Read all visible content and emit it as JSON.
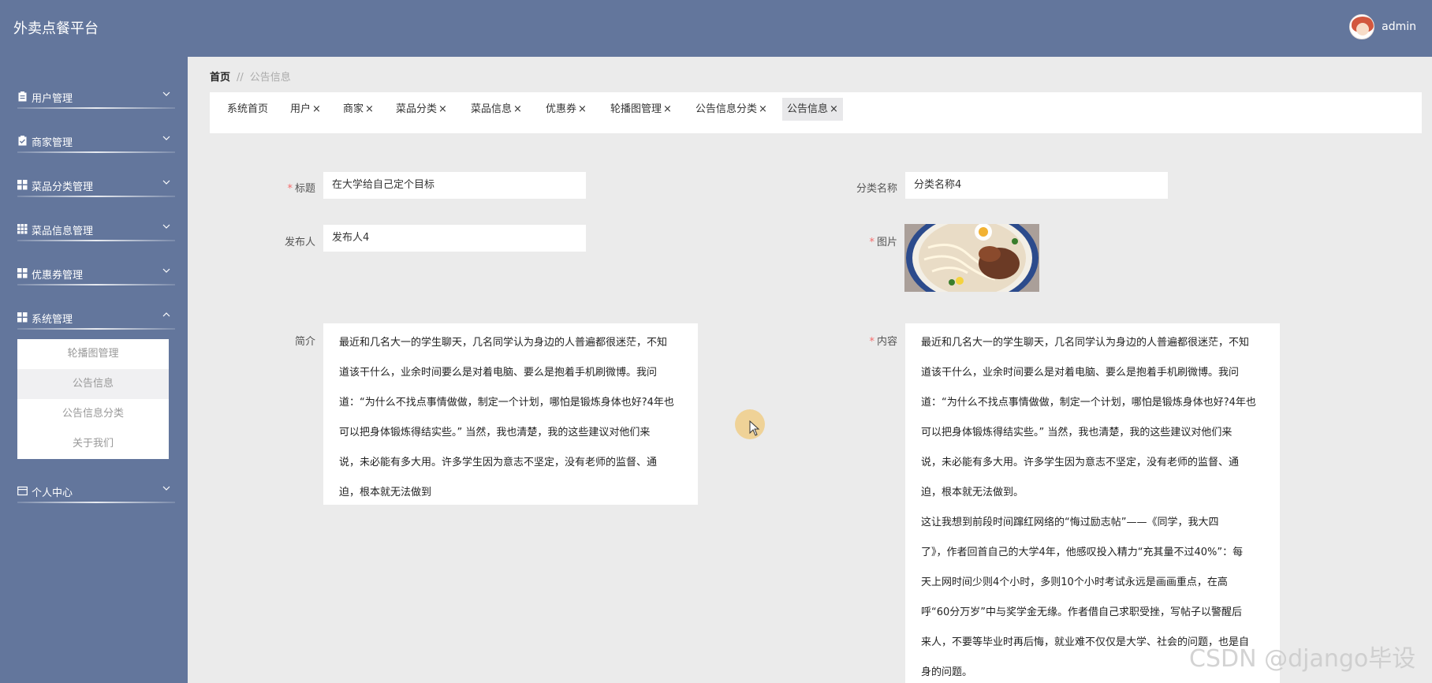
{
  "header": {
    "app_title": "外卖点餐平台",
    "username": "admin"
  },
  "sidebar": {
    "items": [
      {
        "label": "用户管理",
        "icon": "clipboard-icon",
        "expanded": false
      },
      {
        "label": "商家管理",
        "icon": "clipboard-check-icon",
        "expanded": false
      },
      {
        "label": "菜品分类管理",
        "icon": "grid-icon",
        "expanded": false
      },
      {
        "label": "菜品信息管理",
        "icon": "grid-9-icon",
        "expanded": false
      },
      {
        "label": "优惠券管理",
        "icon": "grid-icon",
        "expanded": false
      },
      {
        "label": "系统管理",
        "icon": "grid-icon",
        "expanded": true
      },
      {
        "label": "个人中心",
        "icon": "card-icon",
        "expanded": false
      }
    ],
    "submenu": [
      {
        "label": "轮播图管理",
        "active": false
      },
      {
        "label": "公告信息",
        "active": true
      },
      {
        "label": "公告信息分类",
        "active": false
      },
      {
        "label": "关于我们",
        "active": false
      }
    ]
  },
  "breadcrumb": {
    "home": "首页",
    "separator": "//",
    "current": "公告信息"
  },
  "tabs": [
    {
      "label": "系统首页",
      "closable": false
    },
    {
      "label": "用户",
      "closable": true
    },
    {
      "label": "商家",
      "closable": true
    },
    {
      "label": "菜品分类",
      "closable": true
    },
    {
      "label": "菜品信息",
      "closable": true
    },
    {
      "label": "优惠券",
      "closable": true
    },
    {
      "label": "轮播图管理",
      "closable": true
    },
    {
      "label": "公告信息分类",
      "closable": true
    },
    {
      "label": "公告信息",
      "closable": true,
      "active": true
    }
  ],
  "tab_close_glyph": "×",
  "form": {
    "title_label": "标题",
    "title_value": "在大学给自己定个目标",
    "category_label": "分类名称",
    "category_value": "分类名称4",
    "publisher_label": "发布人",
    "publisher_value": "发布人4",
    "image_label": "图片",
    "intro_label": "简介",
    "intro_lines": [
      "最近和几名大一的学生聊天，几名同学认为身边的人普遍都很迷茫，不知",
      "道该干什么，业余时间要么是对着电脑、要么是抱着手机刷微博。我问",
      "道：“为什么不找点事情做做，制定一个计划，哪怕是锻炼身体也好?4年也",
      "可以把身体锻炼得结实些。” 当然，我也清楚，我的这些建议对他们来",
      "说，未必能有多大用。许多学生因为意志不坚定，没有老师的监督、通",
      "迫，根本就无法做到"
    ],
    "content_label": "内容",
    "content_lines": [
      "最近和几名大一的学生聊天，几名同学认为身边的人普遍都很迷茫，不知",
      "道该干什么，业余时间要么是对着电脑、要么是抱着手机刷微博。我问",
      "道：“为什么不找点事情做做，制定一个计划，哪怕是锻炼身体也好?4年也",
      "可以把身体锻炼得结实些。” 当然，我也清楚，我的这些建议对他们来",
      "说，未必能有多大用。许多学生因为意志不坚定，没有老师的监督、通",
      "迫，根本就无法做到。",
      "这让我想到前段时间蹿红网络的“悔过励志帖”——《同学，我大四",
      "了》，作者回首自己的大学4年，他感叹投入精力“充其量不过40%”：每",
      "天上网时间少则4个小时，多则10个小时考试永远是画画重点，在高",
      "呼“60分万岁”中与奖学金无缘。作者借自己求职受挫，写帖子以警醒后",
      "来人，不要等毕业时再后悔，就业难不仅仅是大学、社会的问题，也是自",
      "身的问题。"
    ]
  },
  "watermark": "CSDN @django毕设",
  "colors": {
    "header_bg": "#63769c",
    "page_bg": "#ebebeb",
    "required": "#f56c6c"
  }
}
